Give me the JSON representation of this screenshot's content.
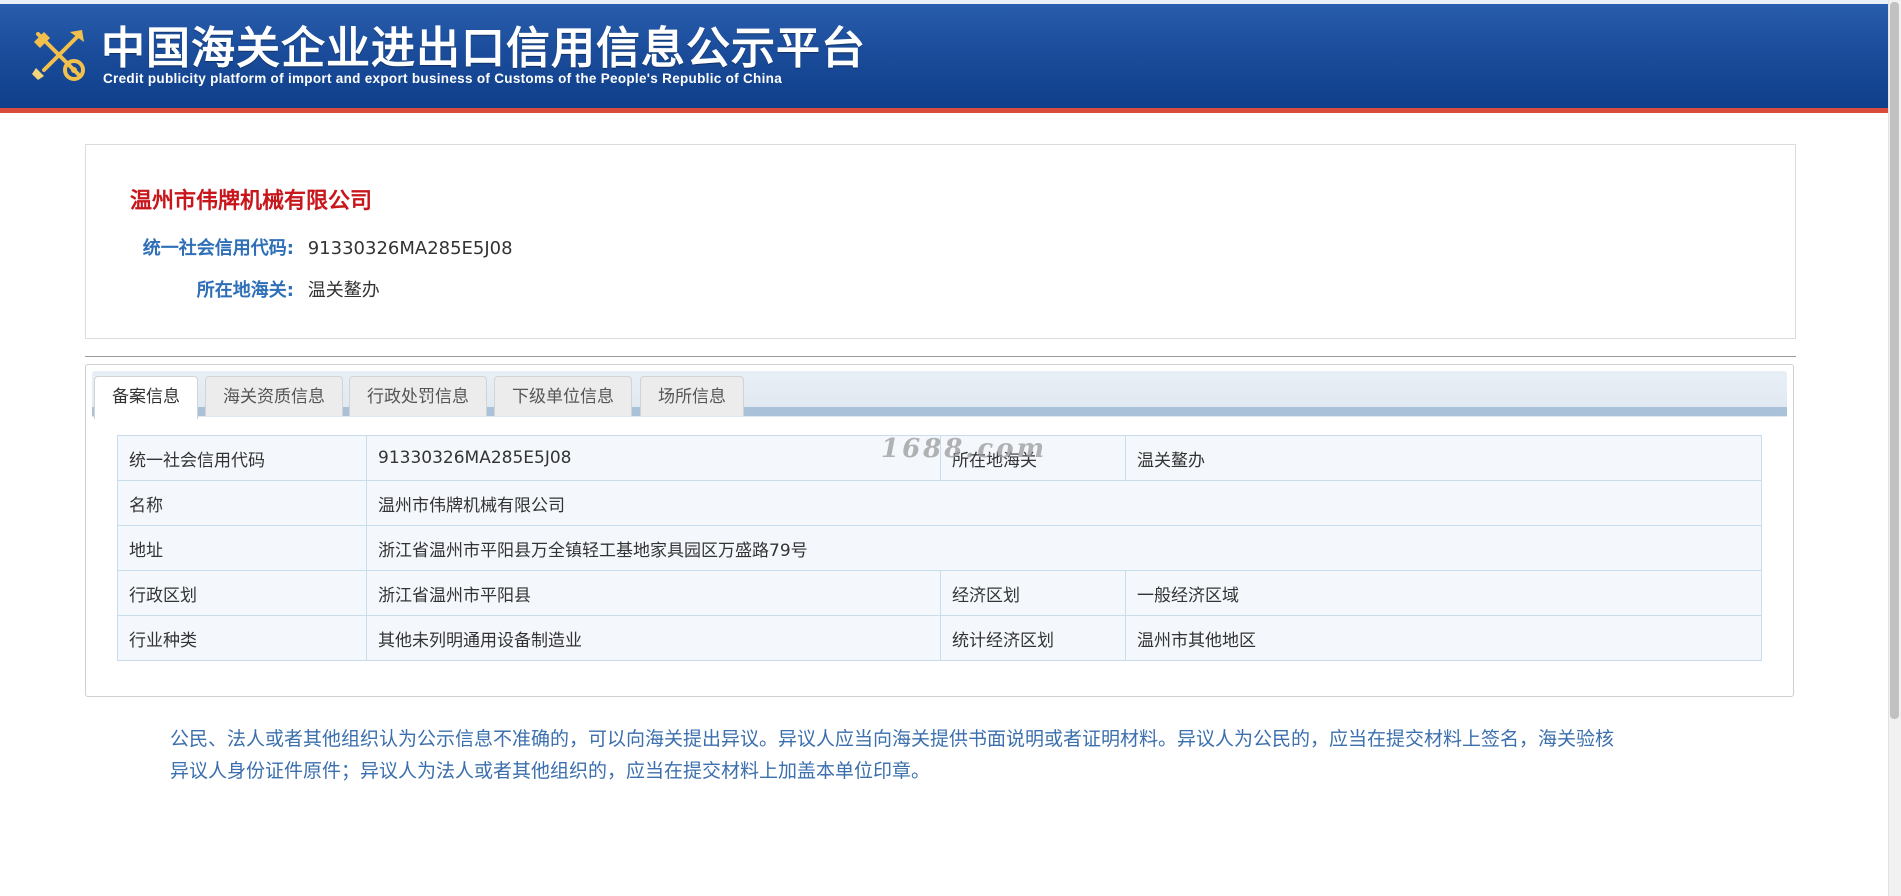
{
  "header": {
    "title": "中国海关企业进出口信用信息公示平台",
    "subtitle": "Credit publicity platform of import and export business of Customs of the People's Republic of China",
    "logo_icon": "customs-emblem-icon"
  },
  "summary": {
    "company_name": "温州市伟牌机械有限公司",
    "credit_code_label": "统一社会信用代码:",
    "credit_code_value": "91330326MA285E5J08",
    "customs_label": "所在地海关:",
    "customs_value": "温关鳌办"
  },
  "tabs": [
    {
      "label": "备案信息",
      "active": true
    },
    {
      "label": "海关资质信息",
      "active": false
    },
    {
      "label": "行政处罚信息",
      "active": false
    },
    {
      "label": "下级单位信息",
      "active": false
    },
    {
      "label": "场所信息",
      "active": false
    }
  ],
  "table": {
    "row1": {
      "label1": "统一社会信用代码",
      "value1": "91330326MA285E5J08",
      "label2": "所在地海关",
      "value2": "温关鳌办"
    },
    "row2": {
      "label": "名称",
      "value": "温州市伟牌机械有限公司"
    },
    "row3": {
      "label": "地址",
      "value": "浙江省温州市平阳县万全镇轻工基地家具园区万盛路79号"
    },
    "row4": {
      "label1": "行政区划",
      "value1": "浙江省温州市平阳县",
      "label2": "经济区划",
      "value2": "一般经济区域"
    },
    "row5": {
      "label1": "行业种类",
      "value1": "其他未列明通用设备制造业",
      "label2": "统计经济区划",
      "value2": "温州市其他地区"
    }
  },
  "watermark": "1688.com",
  "notice": {
    "line1": "公民、法人或者其他组织认为公示信息不准确的，可以向海关提出异议。异议人应当向海关提供书面说明或者证明材料。异议人为公民的，应当在提交材料上签名，海关验核",
    "line2": "异议人身份证件原件；异议人为法人或者其他组织的，应当在提交材料上加盖本单位印章。"
  },
  "colors": {
    "header_blue": "#1b4d9c",
    "accent_red": "#c8161d",
    "label_blue": "#2f6fb8",
    "notice_blue": "#3b6fad"
  }
}
